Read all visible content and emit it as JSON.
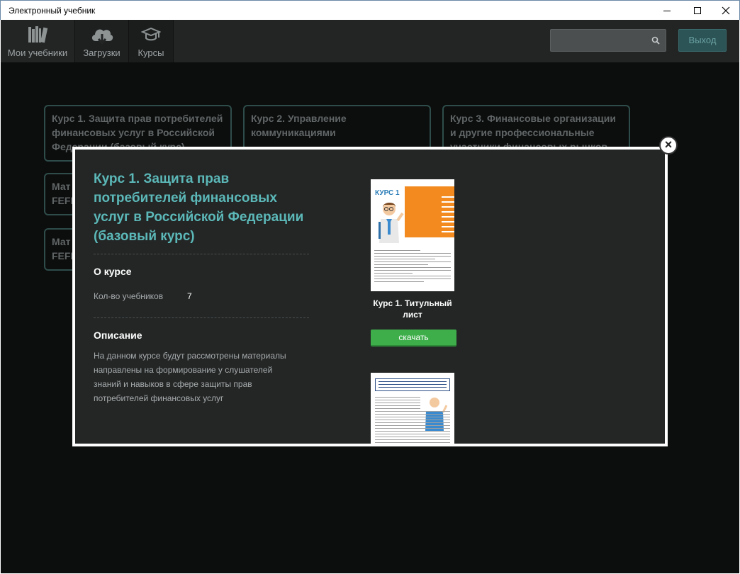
{
  "window": {
    "title": "Электронный учебник"
  },
  "toolbar": {
    "tabs": [
      {
        "label": "Мои учебники",
        "icon": "books-icon"
      },
      {
        "label": "Загрузки",
        "icon": "cloud-download-icon"
      },
      {
        "label": "Курсы",
        "icon": "graduation-cap-icon"
      }
    ],
    "search": {
      "placeholder": "",
      "icon": "search-icon"
    },
    "exit_label": "Выход"
  },
  "courses": [
    {
      "title": "Курс 1. Защита прав потребителей финансовых услуг в Российской Федерации (базовый курс)"
    },
    {
      "title": "Курс 2. Управление коммуникациями"
    },
    {
      "title": "Курс 3. Финансовые организации и другие профессиональные участники финансовых рынков"
    },
    {
      "title": "Мат FEFI"
    },
    {
      "title": "Мат FEFI"
    }
  ],
  "modal": {
    "title": "Курс 1. Защита прав потребителей финансовых услуг в Российской Федерации (базовый курс)",
    "about_heading": "О курсе",
    "textbooks_key": "Кол-во учебников",
    "textbooks_count": "7",
    "description_heading": "Описание",
    "description": "На данном курсе будут рассмотрены материалы направлены на формирование у слушателей знаний и навыков в сфере защиты прав потребителей финансовых услуг",
    "materials": [
      {
        "caption": "Курс 1. Титульный лист",
        "button": "скачать",
        "cover_label": "КУРС 1"
      }
    ],
    "close_icon": "close-icon"
  },
  "colors": {
    "accent": "#5cb8b8",
    "download": "#3eae4b",
    "cover_orange": "#f28a1f"
  }
}
